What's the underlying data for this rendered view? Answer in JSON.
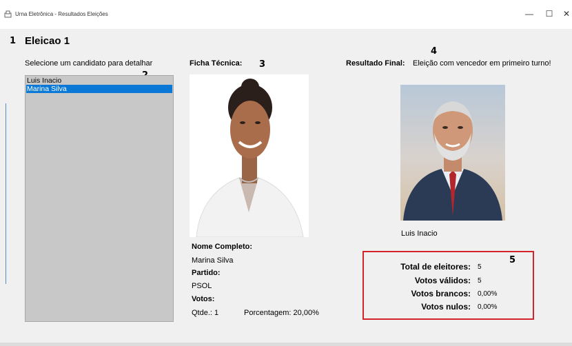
{
  "window": {
    "title": "Urna Eletrônica - Resultados Eleições",
    "minimize_glyph": "—",
    "maximize_glyph": "☐",
    "close_glyph": "✕",
    "app_icon": "ballot-box-icon"
  },
  "annotations": {
    "n1": "1",
    "n2": "2",
    "n3": "3",
    "n4": "4",
    "n5": "5"
  },
  "header": {
    "election_title": "Eleicao 1"
  },
  "candidate_list": {
    "prompt": "Selecione um candidato para detalhar",
    "items": [
      {
        "label": "Luis Inacio",
        "selected": false
      },
      {
        "label": "Marina Silva",
        "selected": true
      }
    ]
  },
  "ficha": {
    "heading": "Ficha Técnica:",
    "nome_label": "Nome Completo:",
    "nome_value": "Marina Silva",
    "partido_label": "Partido:",
    "partido_value": "PSOL",
    "votos_label": "Votos:",
    "qtde": "Qtde.: 1",
    "porcentagem": "Porcentagem: 20,00%"
  },
  "resultado": {
    "heading": "Resultado Final:",
    "message": "Eleição com vencedor em primeiro turno!",
    "winner_name": "Luis Inacio"
  },
  "stats": {
    "total_label": "Total de eleitores:",
    "total_value": "5",
    "validos_label": "Votos válidos:",
    "validos_value": "5",
    "brancos_label": "Votos brancos:",
    "brancos_value": "0,00%",
    "nulos_label": "Votos nulos:",
    "nulos_value": "0,00%"
  },
  "colors": {
    "selection": "#0a78d7",
    "highlight_box": "#d2232a",
    "listbox_bg": "#c8c8c8"
  }
}
